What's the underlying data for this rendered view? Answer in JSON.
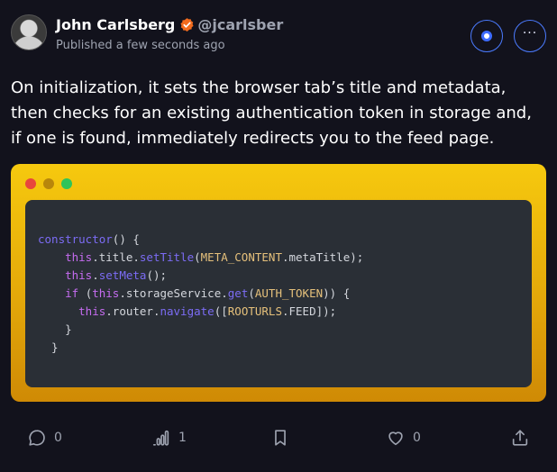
{
  "author": {
    "name": "John Carlsberg",
    "handle": "@jcarlsber",
    "published": "Published a few seconds ago"
  },
  "post": {
    "text": "On initialization, it sets the browser tab’s title and metadata, then checks for an existing authentication token in storage and, if one is found, immediately redirects you to the feed page."
  },
  "code": {
    "lines": [
      [
        {
          "t": "constructor",
          "c": "fn"
        },
        {
          "t": "() {",
          "c": "pl"
        }
      ],
      [
        {
          "t": "    ",
          "c": "pl"
        },
        {
          "t": "this",
          "c": "kw"
        },
        {
          "t": ".title.",
          "c": "pl"
        },
        {
          "t": "setTitle",
          "c": "fn"
        },
        {
          "t": "(",
          "c": "pl"
        },
        {
          "t": "META_CONTENT",
          "c": "cst"
        },
        {
          "t": ".metaTitle);",
          "c": "pl"
        }
      ],
      [
        {
          "t": "    ",
          "c": "pl"
        },
        {
          "t": "this",
          "c": "kw"
        },
        {
          "t": ".",
          "c": "pl"
        },
        {
          "t": "setMeta",
          "c": "fn"
        },
        {
          "t": "();",
          "c": "pl"
        }
      ],
      [
        {
          "t": "    ",
          "c": "pl"
        },
        {
          "t": "if",
          "c": "kw"
        },
        {
          "t": " (",
          "c": "pl"
        },
        {
          "t": "this",
          "c": "kw"
        },
        {
          "t": ".storageService.",
          "c": "pl"
        },
        {
          "t": "get",
          "c": "fn"
        },
        {
          "t": "(",
          "c": "pl"
        },
        {
          "t": "AUTH_TOKEN",
          "c": "cst"
        },
        {
          "t": ")) {",
          "c": "pl"
        }
      ],
      [
        {
          "t": "      ",
          "c": "pl"
        },
        {
          "t": "this",
          "c": "kw"
        },
        {
          "t": ".router.",
          "c": "pl"
        },
        {
          "t": "navigate",
          "c": "fn"
        },
        {
          "t": "([",
          "c": "pl"
        },
        {
          "t": "ROOTURLS",
          "c": "cst"
        },
        {
          "t": ".FEED]);",
          "c": "pl"
        }
      ],
      [
        {
          "t": "    }",
          "c": "pl"
        }
      ],
      [
        {
          "t": "  }",
          "c": "pl"
        }
      ]
    ]
  },
  "actions": {
    "replies": "0",
    "views": "1",
    "likes": "0"
  },
  "icons": {
    "verified": "verified-badge-icon",
    "reply": "comment-icon",
    "views": "analytics-icon",
    "bookmark": "bookmark-icon",
    "like": "heart-icon",
    "share": "share-icon"
  },
  "colors": {
    "background": "#12121c",
    "accent": "#4b7bff",
    "verified": "#f26b1d",
    "card_top": "#f6c90e",
    "card_bottom": "#cf8a05"
  }
}
